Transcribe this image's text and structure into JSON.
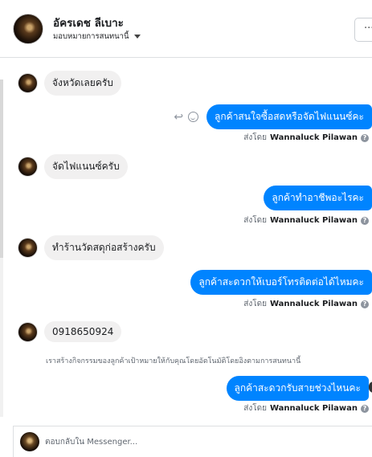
{
  "header": {
    "name": "อัครเดช ลีเบาะ",
    "assign": "มอบหมายการสนทนานี้",
    "more": "···"
  },
  "messages": [
    {
      "direction": "in",
      "text": "จังหวัดเลยครับ"
    },
    {
      "direction": "out",
      "text": "ลูกค้าสนใจซื้อสดหรือจัดไฟแนนซ์คะ",
      "sent_by_label": "ส่งโดย",
      "sender": "Wannaluck Pilawan"
    },
    {
      "direction": "in",
      "text": "จัดไฟแนนซ์ครับ"
    },
    {
      "direction": "out",
      "text": "ลูกค้าทำอาชีพอะไรคะ",
      "sent_by_label": "ส่งโดย",
      "sender": "Wannaluck Pilawan"
    },
    {
      "direction": "in",
      "text": "ทำร้านวัดสดุก่อสร้างครับ"
    },
    {
      "direction": "out",
      "text": "ลูกค้าสะดวกให้เบอร์โทรติดต่อได้ไหมคะ",
      "sent_by_label": "ส่งโดย",
      "sender": "Wannaluck Pilawan"
    },
    {
      "direction": "in",
      "text": "0918650924"
    },
    {
      "direction": "out",
      "text": "ลูกค้าสะดวกรับสายช่วงไหนคะ",
      "sent_by_label": "ส่งโดย",
      "sender": "Wannaluck Pilawan"
    }
  ],
  "notice": "เราสร้างกิจกรรมของลูกค้าเป้าหมายให้กับคุณโดยอัตโนมัติโดยอิงตามการสนทนานี้",
  "composer": {
    "placeholder": "ตอบกลับใน Messenger..."
  },
  "icons": {
    "reply": "reply-icon",
    "emoji": "emoji-icon",
    "info": "info-icon",
    "caret": "caret-down-icon"
  },
  "colors": {
    "outgoing_bubble": "#0084ff",
    "incoming_bubble": "#f1f0f0"
  }
}
